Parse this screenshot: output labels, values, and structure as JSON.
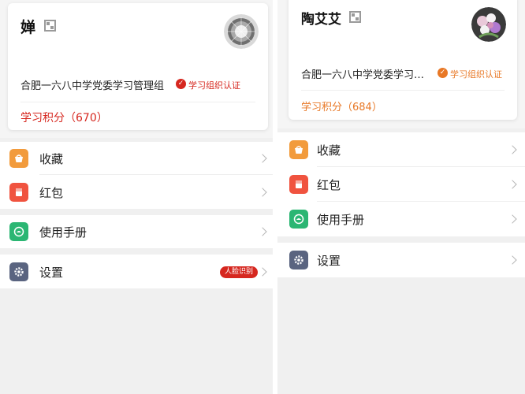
{
  "colors": {
    "accent_red": "#d6271f",
    "accent_orange": "#e87826",
    "favorites_icon": "#f29b3c",
    "red_packet_icon": "#f0533f",
    "manual_icon": "#2bb673",
    "settings_icon": "#5a6480"
  },
  "left": {
    "profile": {
      "name": "婵",
      "qr_icon": "qr-code-icon",
      "organization": "合肥一六八中学党委学习管理组",
      "certification": "学习组织认证",
      "points": "学习积分（670）"
    },
    "menu": [
      {
        "label": "收藏",
        "icon": "favorites-icon"
      },
      {
        "label": "红包",
        "icon": "red-packet-icon"
      },
      {
        "label": "使用手册",
        "icon": "manual-icon"
      },
      {
        "label": "设置",
        "icon": "settings-icon",
        "badge": "人脸识别"
      }
    ]
  },
  "right": {
    "profile": {
      "name": "陶艾艾",
      "qr_icon": "qr-code-icon",
      "organization": "合肥一六八中学党委学习…",
      "certification": "学习组织认证",
      "points": "学习积分（684）"
    },
    "menu": [
      {
        "label": "收藏",
        "icon": "favorites-icon"
      },
      {
        "label": "红包",
        "icon": "red-packet-icon"
      },
      {
        "label": "使用手册",
        "icon": "manual-icon"
      },
      {
        "label": "设置",
        "icon": "settings-icon"
      }
    ]
  }
}
